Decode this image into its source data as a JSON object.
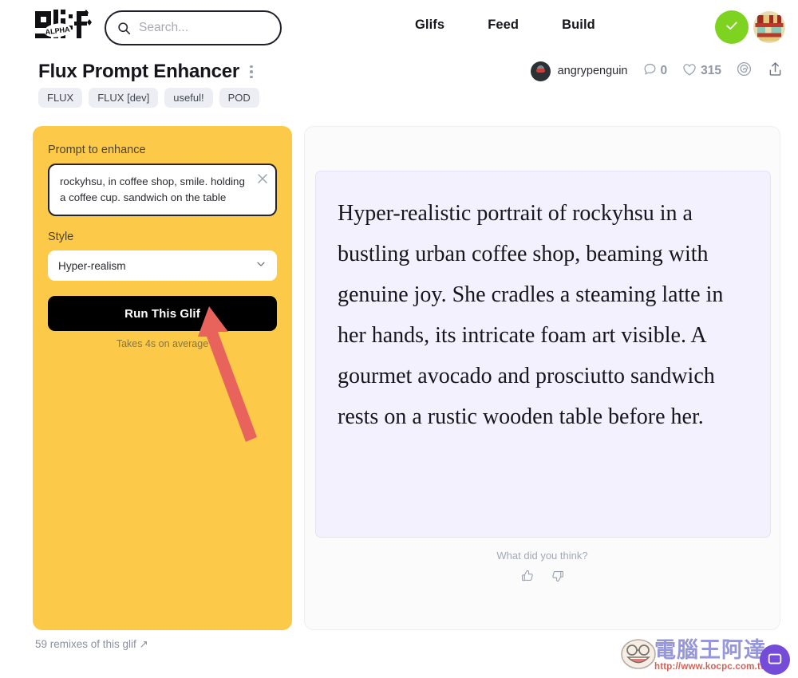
{
  "header": {
    "logo_alt": "glif",
    "logo_badge": "ALPHA",
    "search": {
      "placeholder": "Search...",
      "value": ""
    },
    "nav": [
      {
        "label": "Glifs"
      },
      {
        "label": "Feed"
      },
      {
        "label": "Build"
      }
    ],
    "status_color": "#7ed321",
    "status_icon": "check-icon"
  },
  "glif": {
    "title": "Flux Prompt Enhancer",
    "tags": [
      "FLUX",
      "FLUX [dev]",
      "useful!",
      "POD"
    ],
    "author": "angrypenguin",
    "comments_count": "0",
    "likes_count": "315",
    "remix_text": "59 remixes of this glif ↗"
  },
  "form": {
    "prompt_label": "Prompt to enhance",
    "prompt_value": "rockyhsu, in coffee shop, smile. holding a coffee cup. sandwich on the table",
    "style_label": "Style",
    "style_value": "Hyper-realism",
    "run_button": "Run This Glif",
    "run_note": "Takes 4s on average",
    "panel_color": "#fdc948"
  },
  "output": {
    "text": "Hyper-realistic portrait of rockyhsu in a bustling urban coffee shop, beaming with genuine joy. She cradles a steaming latte in her hands, its intricate foam art visible. A gourmet avocado and prosciutto sandwich rests on a rustic wooden table before her.",
    "background_color": "#f2f1fd"
  },
  "feedback": {
    "question": "What did you think?",
    "up_icon": "thumbs-up-icon",
    "down_icon": "thumbs-down-icon"
  },
  "annotation": {
    "arrow_color": "#e8635c"
  },
  "watermark": {
    "site_name": "電腦王阿達",
    "url": "http://www.kocpc.com.tw"
  }
}
